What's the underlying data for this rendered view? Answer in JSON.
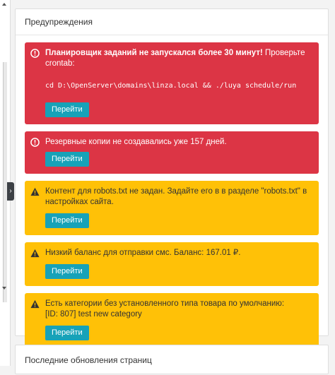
{
  "warnings_panel": {
    "title": "Предупреждения",
    "alerts": [
      {
        "type": "danger",
        "icon": "alert-circle-icon",
        "bold_text": "Планировщик заданий не запускался более 30 минут!",
        "text": " Проверьте crontab:",
        "command": "cd D:\\OpenServer\\domains\\linza.local && ./luya schedule/run",
        "button_label": "Перейти"
      },
      {
        "type": "danger",
        "icon": "alert-circle-icon",
        "text": "Резервные копии не создавались уже 157 дней.",
        "button_label": "Перейти"
      },
      {
        "type": "warning",
        "icon": "warning-triangle-icon",
        "text": "Контент для robots.txt не задан. Задайте его в в разделе \"robots.txt\" в настройках сайта.",
        "button_label": "Перейти"
      },
      {
        "type": "warning",
        "icon": "warning-triangle-icon",
        "text": "Низкий баланс для отправки смс. Баланс: 167.01 ₽.",
        "button_label": "Перейти"
      },
      {
        "type": "warning",
        "icon": "warning-triangle-icon",
        "text": "Есть категории без установленного типа товара по умолчанию:",
        "text2": "[ID: 807] test new category",
        "button_label": "Перейти"
      }
    ]
  },
  "recent_updates_panel": {
    "title": "Последние обновления страниц"
  },
  "sidebar_toggle": {
    "label": "›"
  },
  "colors": {
    "danger": "#dc3545",
    "warning": "#ffc107",
    "button": "#17a2b8"
  }
}
